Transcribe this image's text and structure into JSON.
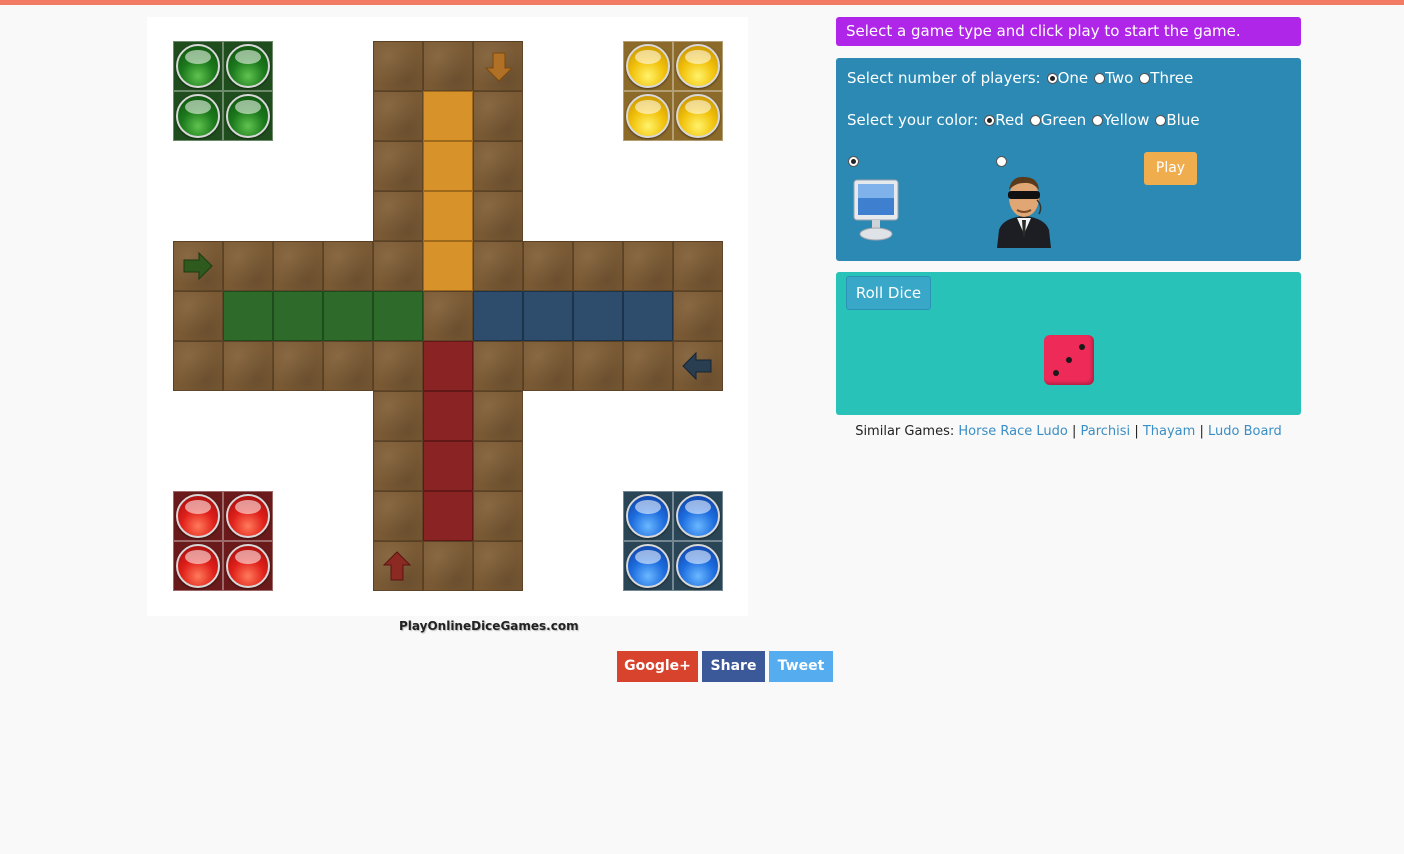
{
  "board": {
    "watermark": "PlayOnlineDiceGames.com",
    "homes": [
      {
        "color": "green",
        "tokens": 4
      },
      {
        "color": "yellow",
        "tokens": 4
      },
      {
        "color": "red",
        "tokens": 4
      },
      {
        "color": "blue",
        "tokens": 4
      }
    ],
    "colors": {
      "green": "#2e6a2a",
      "yellow": "#d8922a",
      "red": "#8a2424",
      "blue": "#2e4c6b",
      "track": "#7a5a35"
    }
  },
  "share": {
    "gplus": "Google+",
    "share": "Share",
    "tweet": "Tweet"
  },
  "message": "Select a game type and click play to start the game.",
  "options": {
    "players_label": "Select number of players:",
    "players": [
      {
        "label": "One",
        "checked": true
      },
      {
        "label": "Two",
        "checked": false
      },
      {
        "label": "Three",
        "checked": false
      }
    ],
    "color_label": "Select your color:",
    "colors": [
      {
        "label": "Red",
        "checked": true
      },
      {
        "label": "Green",
        "checked": false
      },
      {
        "label": "Yellow",
        "checked": false
      },
      {
        "label": "Blue",
        "checked": false
      }
    ],
    "opponent": [
      {
        "name": "computer-icon",
        "checked": true
      },
      {
        "name": "human-agent-icon",
        "checked": false
      }
    ],
    "play": "Play"
  },
  "dice": {
    "roll": "Roll Dice",
    "face": 3
  },
  "similar": {
    "label": "Similar Games:",
    "sep": "|",
    "links": [
      "Horse Race Ludo",
      "Parchisi",
      "Thayam",
      "Ludo Board"
    ]
  }
}
